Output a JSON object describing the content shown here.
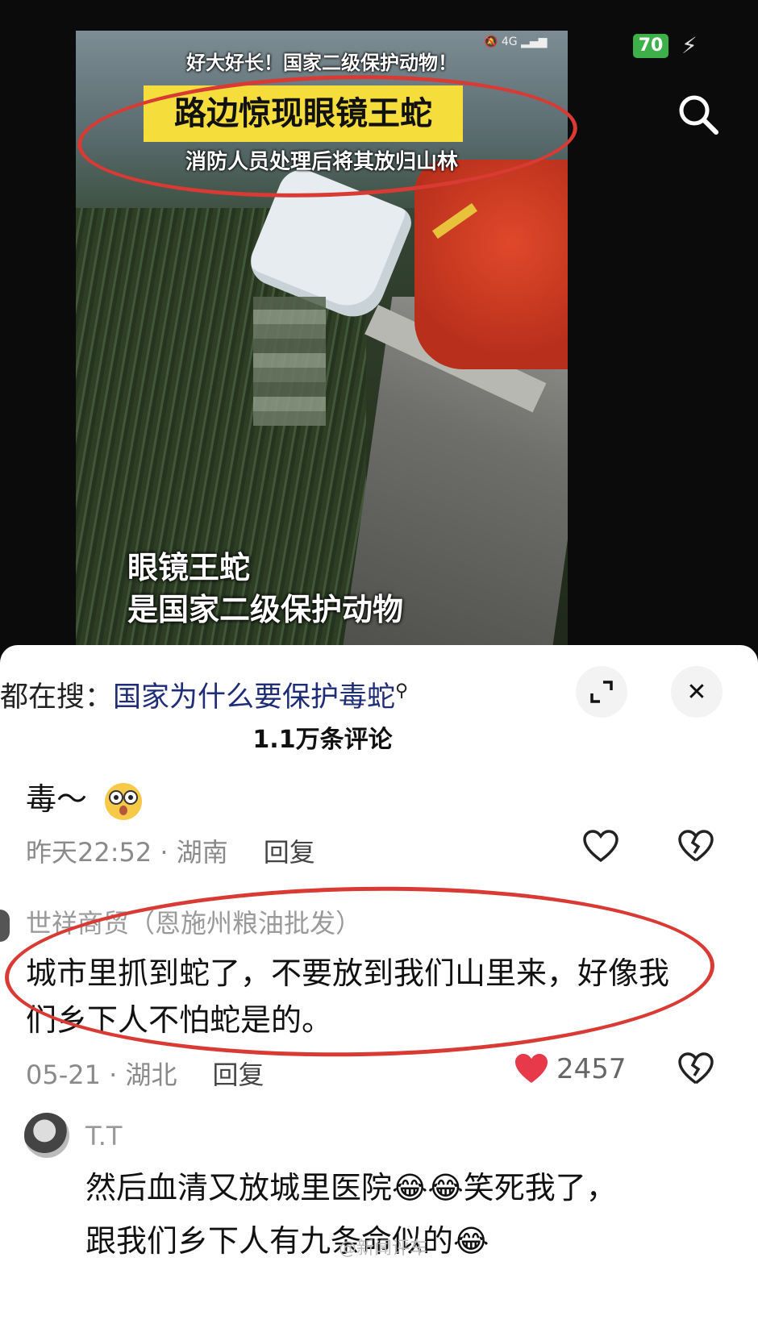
{
  "video": {
    "top_text": "好大好长！国家二级保护动物！",
    "headline": "路边惊现眼镜王蛇",
    "subline": "消防人员处理后将其放归山林",
    "caption_line1": "眼镜王蛇",
    "caption_line2": "是国家二级保护动物"
  },
  "status": {
    "network": "4G",
    "battery": "70"
  },
  "search_bar": {
    "prefix": "都在搜：",
    "query": "国家为什么要保护毒蛇"
  },
  "comments_count": "1.1万条评论",
  "comments": [
    {
      "text": "毒～",
      "time": "昨天22:52",
      "location": "湖南",
      "reply": "回复"
    },
    {
      "author": "世祥商贸（恩施州粮油批发）",
      "text": "城市里抓到蛇了，不要放到我们山里来，好像我们乡下人不怕蛇是的。",
      "time": "05-21",
      "location": "湖北",
      "reply": "回复",
      "likes": "2457"
    },
    {
      "author": "T.T",
      "text_line1": "然后血清又放城里医院😂😂笑死我了，",
      "text_line2": "跟我们乡下人有九条命似的😂"
    }
  ],
  "watermark": "@新闻评车",
  "colors": {
    "annotation_red": "#d93a33",
    "like_red": "#e8394a",
    "headline_yellow": "#f5dd3c"
  }
}
